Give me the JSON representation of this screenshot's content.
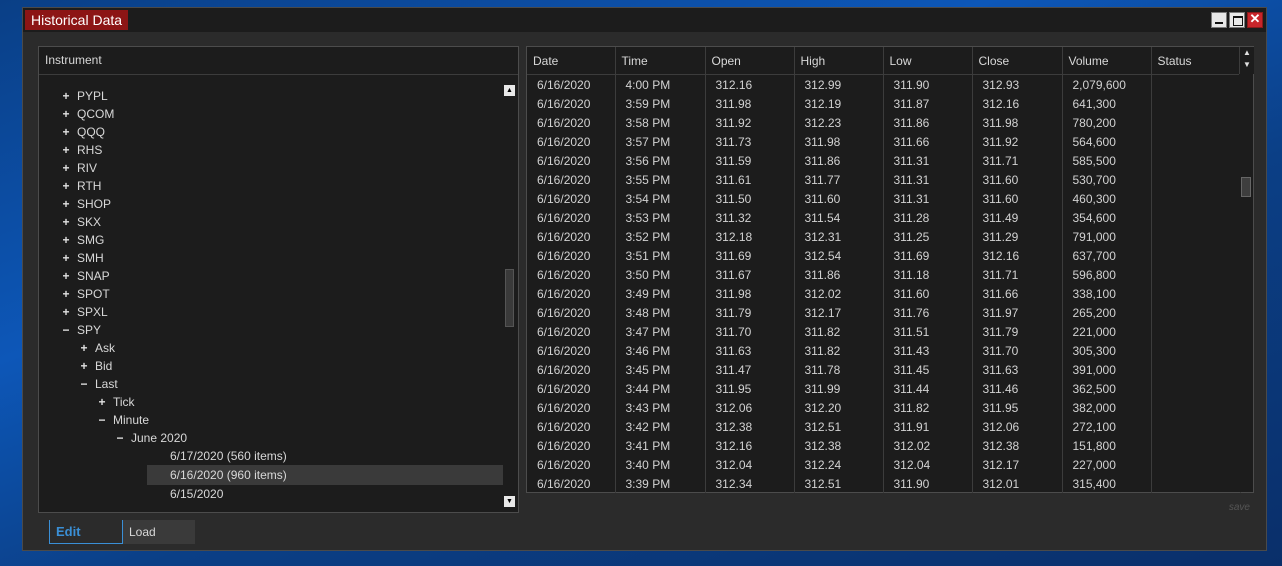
{
  "window": {
    "title": "Historical Data"
  },
  "tree": {
    "header": "Instrument",
    "items": [
      {
        "toggle": "+",
        "label": "PYPL",
        "level": 0
      },
      {
        "toggle": "+",
        "label": "QCOM",
        "level": 0
      },
      {
        "toggle": "+",
        "label": "QQQ",
        "level": 0
      },
      {
        "toggle": "+",
        "label": "RHS",
        "level": 0
      },
      {
        "toggle": "+",
        "label": "RIV",
        "level": 0
      },
      {
        "toggle": "+",
        "label": "RTH",
        "level": 0
      },
      {
        "toggle": "+",
        "label": "SHOP",
        "level": 0
      },
      {
        "toggle": "+",
        "label": "SKX",
        "level": 0
      },
      {
        "toggle": "+",
        "label": "SMG",
        "level": 0
      },
      {
        "toggle": "+",
        "label": "SMH",
        "level": 0
      },
      {
        "toggle": "+",
        "label": "SNAP",
        "level": 0
      },
      {
        "toggle": "+",
        "label": "SPOT",
        "level": 0
      },
      {
        "toggle": "+",
        "label": "SPXL",
        "level": 0
      },
      {
        "toggle": "−",
        "label": "SPY",
        "level": 0
      },
      {
        "toggle": "+",
        "label": "Ask",
        "level": 1
      },
      {
        "toggle": "+",
        "label": "Bid",
        "level": 1
      },
      {
        "toggle": "−",
        "label": "Last",
        "level": 1
      },
      {
        "toggle": "+",
        "label": "Tick",
        "level": 2
      },
      {
        "toggle": "−",
        "label": "Minute",
        "level": 2
      },
      {
        "toggle": "−",
        "label": "June 2020",
        "level": 3
      },
      {
        "toggle": "",
        "label": "6/17/2020 (560 items)",
        "level": 4
      },
      {
        "toggle": "",
        "label": "6/16/2020 (960 items)",
        "level": 4,
        "selected": true
      },
      {
        "toggle": "",
        "label": "6/15/2020",
        "level": 4
      }
    ]
  },
  "grid": {
    "columns": [
      "Date",
      "Time",
      "Open",
      "High",
      "Low",
      "Close",
      "Volume",
      "Status"
    ],
    "rows": [
      [
        "6/16/2020",
        "4:00 PM",
        "312.16",
        "312.99",
        "311.90",
        "312.93",
        "2,079,600",
        ""
      ],
      [
        "6/16/2020",
        "3:59 PM",
        "311.98",
        "312.19",
        "311.87",
        "312.16",
        "641,300",
        ""
      ],
      [
        "6/16/2020",
        "3:58 PM",
        "311.92",
        "312.23",
        "311.86",
        "311.98",
        "780,200",
        ""
      ],
      [
        "6/16/2020",
        "3:57 PM",
        "311.73",
        "311.98",
        "311.66",
        "311.92",
        "564,600",
        ""
      ],
      [
        "6/16/2020",
        "3:56 PM",
        "311.59",
        "311.86",
        "311.31",
        "311.71",
        "585,500",
        ""
      ],
      [
        "6/16/2020",
        "3:55 PM",
        "311.61",
        "311.77",
        "311.31",
        "311.60",
        "530,700",
        ""
      ],
      [
        "6/16/2020",
        "3:54 PM",
        "311.50",
        "311.60",
        "311.31",
        "311.60",
        "460,300",
        ""
      ],
      [
        "6/16/2020",
        "3:53 PM",
        "311.32",
        "311.54",
        "311.28",
        "311.49",
        "354,600",
        ""
      ],
      [
        "6/16/2020",
        "3:52 PM",
        "312.18",
        "312.31",
        "311.25",
        "311.29",
        "791,000",
        ""
      ],
      [
        "6/16/2020",
        "3:51 PM",
        "311.69",
        "312.54",
        "311.69",
        "312.16",
        "637,700",
        ""
      ],
      [
        "6/16/2020",
        "3:50 PM",
        "311.67",
        "311.86",
        "311.18",
        "311.71",
        "596,800",
        ""
      ],
      [
        "6/16/2020",
        "3:49 PM",
        "311.98",
        "312.02",
        "311.60",
        "311.66",
        "338,100",
        ""
      ],
      [
        "6/16/2020",
        "3:48 PM",
        "311.79",
        "312.17",
        "311.76",
        "311.97",
        "265,200",
        ""
      ],
      [
        "6/16/2020",
        "3:47 PM",
        "311.70",
        "311.82",
        "311.51",
        "311.79",
        "221,000",
        ""
      ],
      [
        "6/16/2020",
        "3:46 PM",
        "311.63",
        "311.82",
        "311.43",
        "311.70",
        "305,300",
        ""
      ],
      [
        "6/16/2020",
        "3:45 PM",
        "311.47",
        "311.78",
        "311.45",
        "311.63",
        "391,000",
        ""
      ],
      [
        "6/16/2020",
        "3:44 PM",
        "311.95",
        "311.99",
        "311.44",
        "311.46",
        "362,500",
        ""
      ],
      [
        "6/16/2020",
        "3:43 PM",
        "312.06",
        "312.20",
        "311.82",
        "311.95",
        "382,000",
        ""
      ],
      [
        "6/16/2020",
        "3:42 PM",
        "312.38",
        "312.51",
        "311.91",
        "312.06",
        "272,100",
        ""
      ],
      [
        "6/16/2020",
        "3:41 PM",
        "312.16",
        "312.38",
        "312.02",
        "312.38",
        "151,800",
        ""
      ],
      [
        "6/16/2020",
        "3:40 PM",
        "312.04",
        "312.24",
        "312.04",
        "312.17",
        "227,000",
        ""
      ],
      [
        "6/16/2020",
        "3:39 PM",
        "312.34",
        "312.51",
        "311.90",
        "312.01",
        "315,400",
        ""
      ]
    ],
    "save_label": "save"
  },
  "tabs": {
    "edit": "Edit",
    "load": "Load"
  },
  "colors": {
    "title_bg": "#8c1515",
    "accent": "#3a8fd6",
    "panel_bg": "#1c1c1c"
  }
}
